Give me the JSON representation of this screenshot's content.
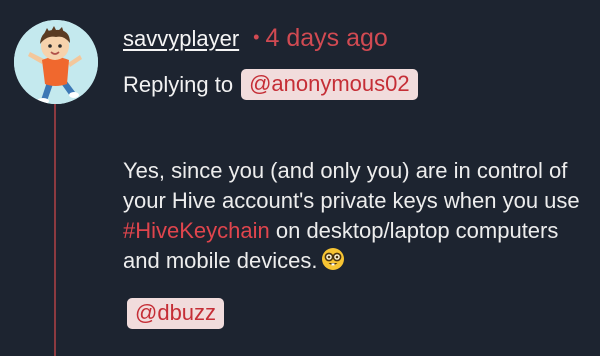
{
  "post": {
    "username": "savvyplayer",
    "time_separator": "•",
    "timestamp": "4 days ago",
    "reply_label": "Replying to",
    "reply_to": "@anonymous02",
    "body_part1": "Yes, since you (and only you) are in control of your Hive account's private keys when you use ",
    "hashtag": "#HiveKeychain",
    "body_part2": " on desktop/laptop computers and mobile devices.",
    "emoji": "nerd-face-icon",
    "mention": "@dbuzz"
  },
  "colors": {
    "background": "#1d2430",
    "accent": "#d14a52",
    "mention_bg": "#f1dcdc",
    "mention_text": "#c52e36",
    "thread_line": "#8c3a40"
  }
}
